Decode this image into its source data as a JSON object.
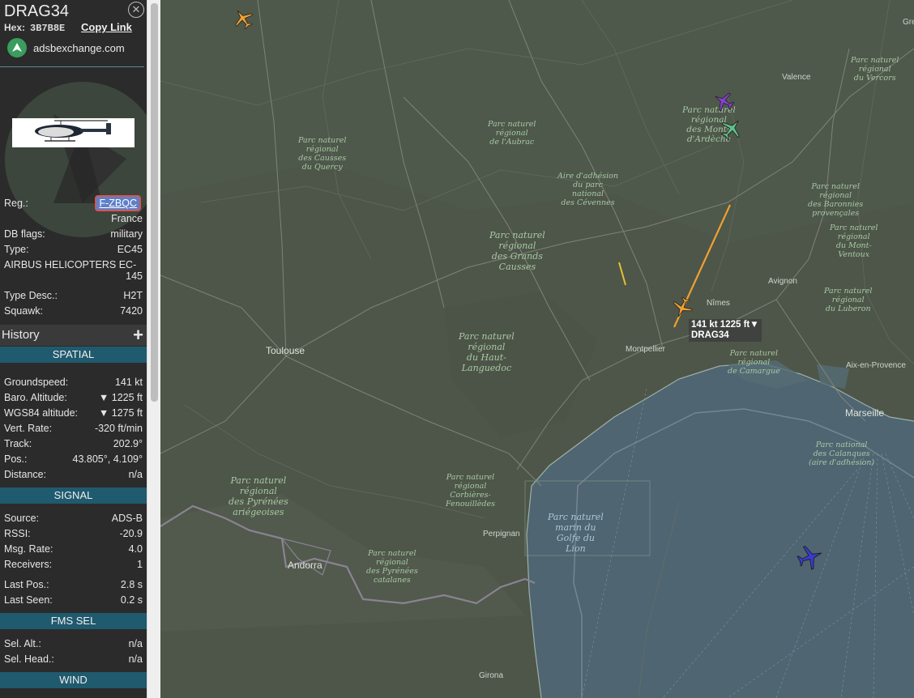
{
  "aircraft": {
    "callsign": "DRAG34",
    "hex_label": "Hex:",
    "hex": "3B7B8E",
    "copy_link": "Copy Link",
    "source_site": "adsbexchange.com",
    "close_icon": "close-icon"
  },
  "details": {
    "reg": {
      "label": "Reg.:",
      "value": "F-ZBQC"
    },
    "country": "France",
    "db_flags": {
      "label": "DB flags:",
      "value": "military"
    },
    "type": {
      "label": "Type:",
      "value": "EC45"
    },
    "type_name_line1": "AIRBUS HELICOPTERS EC-",
    "type_name_line2": "145",
    "type_desc": {
      "label": "Type Desc.:",
      "value": "H2T"
    },
    "squawk": {
      "label": "Squawk:",
      "value": "7420"
    }
  },
  "history": {
    "label": "History",
    "expand": "+"
  },
  "spatial": {
    "title": "SPATIAL",
    "rows": [
      {
        "label": "Groundspeed:",
        "value": "141 kt"
      },
      {
        "label": "Baro. Altitude:",
        "value": "▼ 1225 ft"
      },
      {
        "label": "WGS84 altitude:",
        "value": "▼ 1275 ft"
      },
      {
        "label": "Vert. Rate:",
        "value": "-320 ft/min"
      },
      {
        "label": "Track:",
        "value": "202.9°"
      },
      {
        "label": "Pos.:",
        "value": "43.805°, 4.109°"
      },
      {
        "label": "Distance:",
        "value": "n/a"
      }
    ]
  },
  "signal": {
    "title": "SIGNAL",
    "rows": [
      {
        "label": "Source:",
        "value": "ADS-B"
      },
      {
        "label": "RSSI:",
        "value": "-20.9"
      },
      {
        "label": "Msg. Rate:",
        "value": "4.0"
      },
      {
        "label": "Receivers:",
        "value": "1"
      },
      {
        "label": "Last Pos.:",
        "value": "2.8 s"
      },
      {
        "label": "Last Seen:",
        "value": "0.2 s"
      }
    ]
  },
  "fms": {
    "title": "FMS SEL",
    "rows": [
      {
        "label": "Sel. Alt.:",
        "value": "n/a"
      },
      {
        "label": "Sel. Head.:",
        "value": "n/a"
      }
    ]
  },
  "wind": {
    "title": "WIND"
  },
  "map": {
    "selected_label_line1": "141 kt  1225 ft▼",
    "selected_label_line2": "DRAG34",
    "cities": {
      "toulouse": "Toulouse",
      "montpellier": "Montpellier",
      "nimes": "Nîmes",
      "avignon": "Avignon",
      "valence": "Valence",
      "aix": "Aix-en-Provence",
      "marseille": "Marseille",
      "perpignan": "Perpignan",
      "andorra": "Andorra",
      "girona": "Girona",
      "gre": "Gre"
    },
    "parks": {
      "quercy": "Parc naturel\nrégional\ndes Causses\ndu Quercy",
      "aubrac": "Parc naturel\nrégional\nde l'Aubrac",
      "ardeche": "Parc naturel\nrégional\ndes Monts\nd'Ardèche",
      "vercors": "Parc naturel\nrégional\ndu Vercors",
      "cevennes": "Aire d'adhésion\ndu parc\nnational\ndes Cévennes",
      "baronnies": "Parc naturel\nrégional\ndes Baronnies\nprovençales",
      "ventoux": "Parc naturel\nrégional\ndu Mont-\nVentoux",
      "grands_causses": "Parc naturel\nrégional\ndes Grands\nCausses",
      "luberon": "Parc naturel\nrégional\ndu Luberon",
      "haut_languedoc": "Parc naturel\nrégional\ndu Haut-\nLanguedoc",
      "camargue": "Parc naturel\nrégional\nde Camargue",
      "calanques": "Parc national\ndes Calanques\n(aire d'adhésion)",
      "pyrenees_ariegeoises": "Parc naturel\nrégional\ndes Pyrénées\nariégeoises",
      "corbieres": "Parc naturel\nrégional\nCorbières-\nFenouillèdes",
      "pyrenees_catalanes": "Parc naturel\nrégional\ndes Pyrénées\ncatalanes",
      "golfe_lion": "Parc naturel\nmarin du\nGolfe du\nLion"
    },
    "colors": {
      "track": "#f0a030",
      "selected_aircraft": "#f0a030",
      "aircraft_purple": "#8a3fd6",
      "aircraft_green": "#5fc28a",
      "aircraft_blue": "#3a3ad6",
      "sea": "#4f6571",
      "land": "#4d5649"
    }
  }
}
